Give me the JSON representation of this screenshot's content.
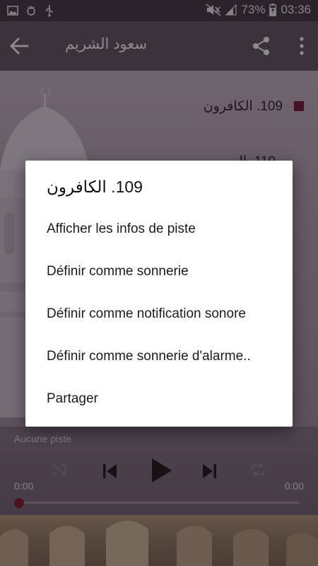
{
  "status_bar": {
    "battery_percent": "73%",
    "time": "03:36",
    "icons": [
      "image-icon",
      "android-debug-icon",
      "usb-icon",
      "mute-icon",
      "signal-icon",
      "battery-icon"
    ]
  },
  "toolbar": {
    "title": "سعود الشريم",
    "icons": [
      "back-arrow-icon",
      "share-icon",
      "more-vert-icon"
    ]
  },
  "tracks": [
    {
      "label": "109. الكافرون",
      "playing": true
    },
    {
      "label": "110. ال",
      "playing": false
    }
  ],
  "dialog": {
    "title": "109. الكافرون",
    "items": [
      "Afficher les infos de piste",
      "Définir comme sonnerie",
      "Définir comme notification sonore",
      "Définir comme sonnerie d'alarme..",
      "Partager"
    ]
  },
  "player": {
    "status_text": "Aucune piste",
    "current_time": "0:00",
    "total_time": "0:00",
    "progress": 0,
    "controls": [
      "shuffle-icon",
      "skip-previous-icon",
      "play-icon",
      "skip-next-icon",
      "repeat-icon"
    ]
  },
  "colors": {
    "toolbar": "#6e5c6d",
    "accent": "#8b1e3a",
    "dialog_bg": "#ffffff"
  }
}
